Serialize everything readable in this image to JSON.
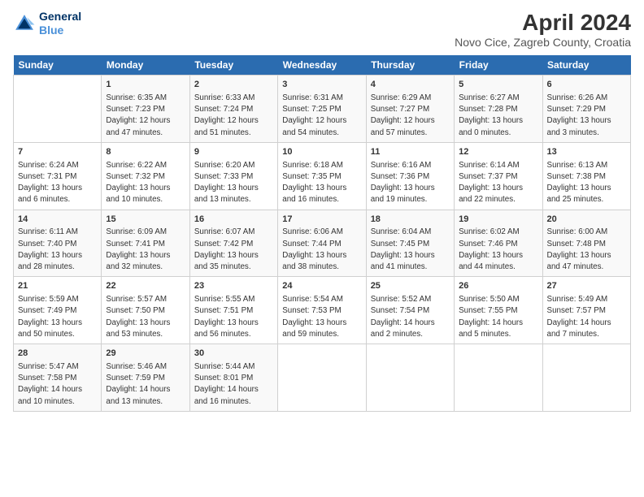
{
  "logo": {
    "line1": "General",
    "line2": "Blue"
  },
  "title": "April 2024",
  "subtitle": "Novo Cice, Zagreb County, Croatia",
  "days_header": [
    "Sunday",
    "Monday",
    "Tuesday",
    "Wednesday",
    "Thursday",
    "Friday",
    "Saturday"
  ],
  "weeks": [
    [
      {
        "num": "",
        "info": ""
      },
      {
        "num": "1",
        "info": "Sunrise: 6:35 AM\nSunset: 7:23 PM\nDaylight: 12 hours\nand 47 minutes."
      },
      {
        "num": "2",
        "info": "Sunrise: 6:33 AM\nSunset: 7:24 PM\nDaylight: 12 hours\nand 51 minutes."
      },
      {
        "num": "3",
        "info": "Sunrise: 6:31 AM\nSunset: 7:25 PM\nDaylight: 12 hours\nand 54 minutes."
      },
      {
        "num": "4",
        "info": "Sunrise: 6:29 AM\nSunset: 7:27 PM\nDaylight: 12 hours\nand 57 minutes."
      },
      {
        "num": "5",
        "info": "Sunrise: 6:27 AM\nSunset: 7:28 PM\nDaylight: 13 hours\nand 0 minutes."
      },
      {
        "num": "6",
        "info": "Sunrise: 6:26 AM\nSunset: 7:29 PM\nDaylight: 13 hours\nand 3 minutes."
      }
    ],
    [
      {
        "num": "7",
        "info": "Sunrise: 6:24 AM\nSunset: 7:31 PM\nDaylight: 13 hours\nand 6 minutes."
      },
      {
        "num": "8",
        "info": "Sunrise: 6:22 AM\nSunset: 7:32 PM\nDaylight: 13 hours\nand 10 minutes."
      },
      {
        "num": "9",
        "info": "Sunrise: 6:20 AM\nSunset: 7:33 PM\nDaylight: 13 hours\nand 13 minutes."
      },
      {
        "num": "10",
        "info": "Sunrise: 6:18 AM\nSunset: 7:35 PM\nDaylight: 13 hours\nand 16 minutes."
      },
      {
        "num": "11",
        "info": "Sunrise: 6:16 AM\nSunset: 7:36 PM\nDaylight: 13 hours\nand 19 minutes."
      },
      {
        "num": "12",
        "info": "Sunrise: 6:14 AM\nSunset: 7:37 PM\nDaylight: 13 hours\nand 22 minutes."
      },
      {
        "num": "13",
        "info": "Sunrise: 6:13 AM\nSunset: 7:38 PM\nDaylight: 13 hours\nand 25 minutes."
      }
    ],
    [
      {
        "num": "14",
        "info": "Sunrise: 6:11 AM\nSunset: 7:40 PM\nDaylight: 13 hours\nand 28 minutes."
      },
      {
        "num": "15",
        "info": "Sunrise: 6:09 AM\nSunset: 7:41 PM\nDaylight: 13 hours\nand 32 minutes."
      },
      {
        "num": "16",
        "info": "Sunrise: 6:07 AM\nSunset: 7:42 PM\nDaylight: 13 hours\nand 35 minutes."
      },
      {
        "num": "17",
        "info": "Sunrise: 6:06 AM\nSunset: 7:44 PM\nDaylight: 13 hours\nand 38 minutes."
      },
      {
        "num": "18",
        "info": "Sunrise: 6:04 AM\nSunset: 7:45 PM\nDaylight: 13 hours\nand 41 minutes."
      },
      {
        "num": "19",
        "info": "Sunrise: 6:02 AM\nSunset: 7:46 PM\nDaylight: 13 hours\nand 44 minutes."
      },
      {
        "num": "20",
        "info": "Sunrise: 6:00 AM\nSunset: 7:48 PM\nDaylight: 13 hours\nand 47 minutes."
      }
    ],
    [
      {
        "num": "21",
        "info": "Sunrise: 5:59 AM\nSunset: 7:49 PM\nDaylight: 13 hours\nand 50 minutes."
      },
      {
        "num": "22",
        "info": "Sunrise: 5:57 AM\nSunset: 7:50 PM\nDaylight: 13 hours\nand 53 minutes."
      },
      {
        "num": "23",
        "info": "Sunrise: 5:55 AM\nSunset: 7:51 PM\nDaylight: 13 hours\nand 56 minutes."
      },
      {
        "num": "24",
        "info": "Sunrise: 5:54 AM\nSunset: 7:53 PM\nDaylight: 13 hours\nand 59 minutes."
      },
      {
        "num": "25",
        "info": "Sunrise: 5:52 AM\nSunset: 7:54 PM\nDaylight: 14 hours\nand 2 minutes."
      },
      {
        "num": "26",
        "info": "Sunrise: 5:50 AM\nSunset: 7:55 PM\nDaylight: 14 hours\nand 5 minutes."
      },
      {
        "num": "27",
        "info": "Sunrise: 5:49 AM\nSunset: 7:57 PM\nDaylight: 14 hours\nand 7 minutes."
      }
    ],
    [
      {
        "num": "28",
        "info": "Sunrise: 5:47 AM\nSunset: 7:58 PM\nDaylight: 14 hours\nand 10 minutes."
      },
      {
        "num": "29",
        "info": "Sunrise: 5:46 AM\nSunset: 7:59 PM\nDaylight: 14 hours\nand 13 minutes."
      },
      {
        "num": "30",
        "info": "Sunrise: 5:44 AM\nSunset: 8:01 PM\nDaylight: 14 hours\nand 16 minutes."
      },
      {
        "num": "",
        "info": ""
      },
      {
        "num": "",
        "info": ""
      },
      {
        "num": "",
        "info": ""
      },
      {
        "num": "",
        "info": ""
      }
    ]
  ]
}
